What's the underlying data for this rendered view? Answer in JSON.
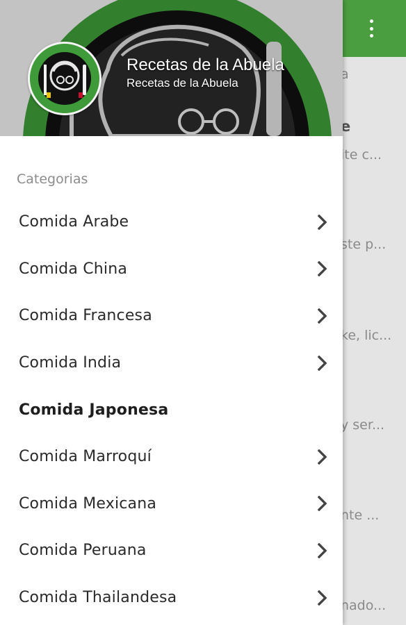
{
  "header": {
    "title": "Recetas de la Abuela",
    "subtitle": "Recetas de la Abuela"
  },
  "drawer": {
    "section_label": "Categorias",
    "items": [
      {
        "label": "Comida Arabe",
        "has_chevron": true,
        "active": false
      },
      {
        "label": "Comida China",
        "has_chevron": true,
        "active": false
      },
      {
        "label": "Comida Francesa",
        "has_chevron": true,
        "active": false
      },
      {
        "label": "Comida India",
        "has_chevron": true,
        "active": false
      },
      {
        "label": "Comida Japonesa",
        "has_chevron": false,
        "active": true
      },
      {
        "label": "Comida Marroquí",
        "has_chevron": true,
        "active": false
      },
      {
        "label": "Comida Mexicana",
        "has_chevron": true,
        "active": false
      },
      {
        "label": "Comida Peruana",
        "has_chevron": true,
        "active": false
      },
      {
        "label": "Comida Thailandesa",
        "has_chevron": true,
        "active": false
      }
    ]
  },
  "background_list": {
    "snippets": [
      "a",
      "e",
      "ite c...",
      "ste p...",
      "ke, lic...",
      "y ser...",
      "nte ...",
      "nado..."
    ]
  },
  "icons": {
    "overflow": "more-vert-icon",
    "chevron": "chevron-right-icon",
    "logo": "grandmother-plate-icon"
  },
  "colors": {
    "appbar": "#4a9e3f",
    "accent_green": "#3f9a3a",
    "drawer_bg": "#ffffff",
    "scrim_bg": "#e4e4e4"
  }
}
